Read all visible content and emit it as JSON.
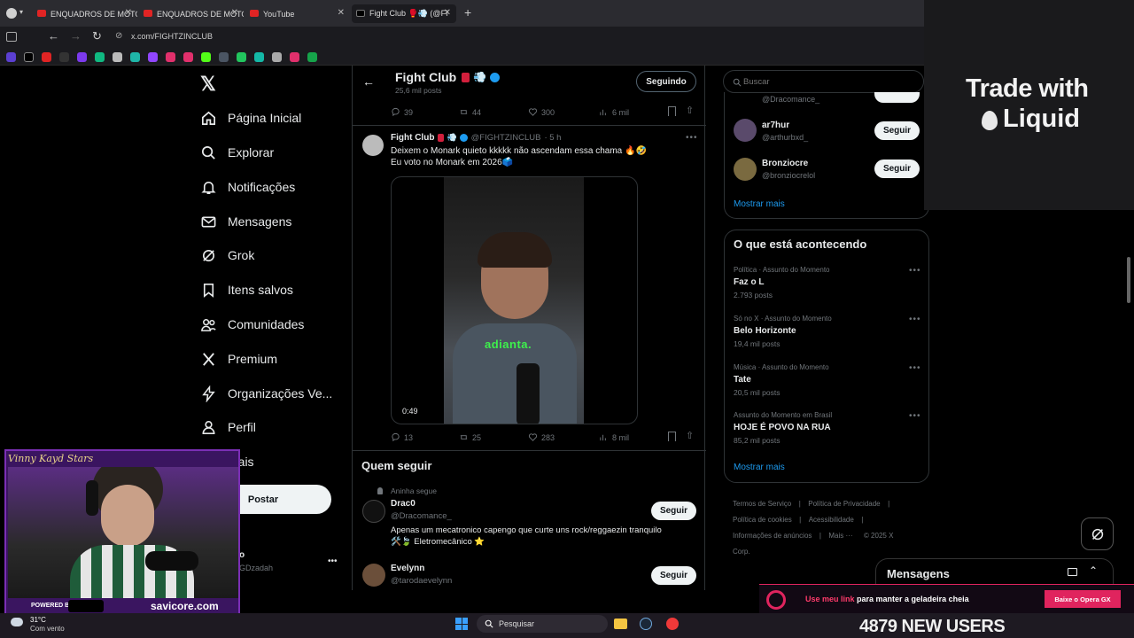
{
  "browser": {
    "tabs": [
      {
        "label": "ENQUADROS DE MOTO"
      },
      {
        "label": "ENQUADROS DE MOTO"
      },
      {
        "label": "YouTube"
      },
      {
        "label": "Fight Club 🥊💨 (@FI"
      }
    ],
    "url": "x.com/FIGHTZINCLUB"
  },
  "nav": {
    "items": [
      "Página Inicial",
      "Explorar",
      "Notificações",
      "Mensagens",
      "Grok",
      "Itens salvos",
      "Comunidades",
      "Premium",
      "Organizações Ve...",
      "Perfil",
      "Mais"
    ],
    "post_button": "Postar",
    "account_handle_partial": "GDzadah",
    "account_name_partial": "o"
  },
  "profile_header": {
    "name": "Fight Club",
    "posts": "25,6 mil posts",
    "follow_state": "Seguindo"
  },
  "prev_tweet_stats": {
    "replies": "39",
    "retweets": "44",
    "likes": "300",
    "views": "6 mil"
  },
  "tweet": {
    "name": "Fight Club",
    "handle": "@FIGHTZINCLUB",
    "time": "· 5 h",
    "line1": "Deixem o Monark quieto kkkkk não ascendam essa chama 🔥🤣",
    "line2": "Eu voto no Monark em 2026🗳️",
    "video_caption": "adianta.",
    "video_duration": "0:49",
    "stats": {
      "replies": "13",
      "retweets": "25",
      "likes": "283",
      "views": "8 mil"
    }
  },
  "who_to_follow": {
    "title": "Quem seguir",
    "followed_by": "Aninha segue",
    "users": [
      {
        "name": "Drac0",
        "handle": "@Dracomance_",
        "bio": "Apenas um mecatronico capengo que curte uns rock/reggaezin tranquilo",
        "bio2": "🛠️🍃 Eletromecânico ⭐",
        "button": "Seguir"
      },
      {
        "name": "Evelynn",
        "handle": "@tarodaevelynn",
        "button": "Seguir"
      }
    ]
  },
  "right": {
    "search_placeholder": "Buscar",
    "suggestions": [
      {
        "handle": "@Dracomance_"
      },
      {
        "name": "ar7hur",
        "handle": "@arthurbxd_",
        "button": "Seguir"
      },
      {
        "name": "Bronziocre",
        "handle": "@bronziocrelol",
        "button": "Seguir"
      }
    ],
    "show_more": "Mostrar mais",
    "trends_title": "O que está acontecendo",
    "trends": [
      {
        "category": "Política · Assunto do Momento",
        "name": "Faz o L",
        "count": "2.793 posts"
      },
      {
        "category": "Só no X · Assunto do Momento",
        "name": "Belo Horizonte",
        "count": "19,4 mil posts"
      },
      {
        "category": "Música · Assunto do Momento",
        "name": "Tate",
        "count": "20,5 mil posts"
      },
      {
        "category": "Assunto do Momento em Brasil",
        "name": "HOJE É POVO NA RUA",
        "count": "85,2 mil posts"
      }
    ],
    "trends_more": "Mostrar mais",
    "footer": [
      "Termos de Serviço",
      "|",
      "Política de Privacidade",
      "|",
      "Política de cookies",
      "|",
      "Acessibilidade",
      "|",
      "Informações de anúncios",
      "|",
      "Mais ···",
      "© 2025 X Corp."
    ],
    "messages": "Mensagens"
  },
  "overlay": {
    "ad_text_1": "Trade with",
    "ad_text_2": "Liquid",
    "powered_by": "POWERED BY",
    "sponsor": "savicore.com",
    "banner_highlight": "Use meu link",
    "banner_text": " para manter a geladeira cheia",
    "banner_button": "Baixe o Opera GX",
    "users_counter": "4879 NEW USERS",
    "signature": "Vinny Kayd Stars"
  },
  "taskbar": {
    "temperature": "31°C",
    "weather": "Com vento",
    "search": "Pesquisar"
  },
  "colors": {
    "accent": "#1d9bf0",
    "bg": "#000000",
    "border": "#2f3336",
    "banner": "#e0245e"
  }
}
